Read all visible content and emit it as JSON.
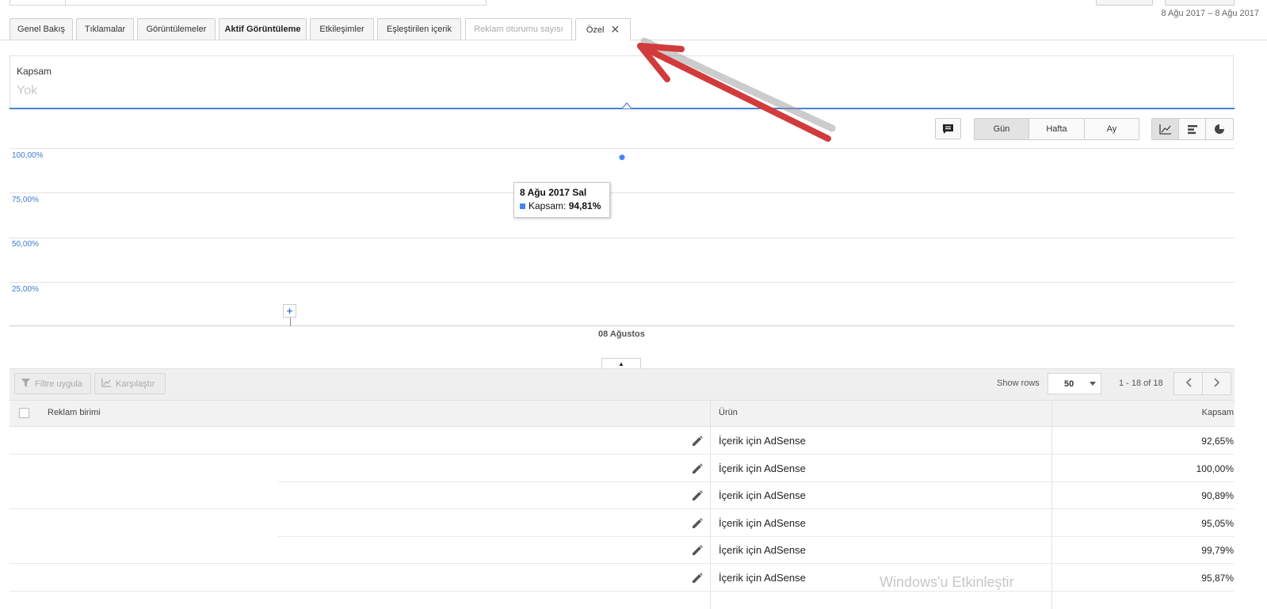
{
  "header": {
    "date_range": "8 Ağu 2017 – 8 Ağu 2017"
  },
  "tabs": [
    {
      "label": "Genel Bakış"
    },
    {
      "label": "Tıklamalar"
    },
    {
      "label": "Görüntülemeler"
    },
    {
      "label": "Aktif Görüntüleme"
    },
    {
      "label": "Etkileşimler"
    },
    {
      "label": "Eşleştirilen içerik"
    },
    {
      "label": "Reklam oturumu sayısı"
    },
    {
      "label": "Özel",
      "close": "✕"
    }
  ],
  "scope": {
    "label": "Kapsam",
    "value": "Yok"
  },
  "chart_toolbar": {
    "comment_icon": "comment-icon",
    "period": [
      "Gün",
      "Hafta",
      "Ay"
    ],
    "selected_period": "Gün",
    "view_icons": [
      "line-chart-icon",
      "bar-chart-icon",
      "pie-chart-icon"
    ]
  },
  "chart_data": {
    "type": "line",
    "y_ticks": [
      "100,00%",
      "75,00%",
      "50,00%",
      "25,00%"
    ],
    "x_labels": [
      "08 Ağustos"
    ],
    "series": [
      {
        "name": "Kapsam",
        "values": [
          94.81
        ]
      }
    ],
    "tooltip": {
      "date": "8 Ağu 2017 Sal",
      "label": "Kapsam:",
      "value": "94,81%"
    }
  },
  "table_toolbar": {
    "filter_label": "Filtre uygula",
    "compare_label": "Karşılaştır",
    "show_rows_label": "Show rows",
    "rows_value": "50",
    "pager_text": "1 - 18 of 18"
  },
  "table": {
    "columns": [
      "Reklam birimi",
      "Ürün",
      "Kapsam"
    ],
    "rows": [
      {
        "product": "İçerik için AdSense",
        "value": "92,65%"
      },
      {
        "product": "İçerik için AdSense",
        "value": "100,00%"
      },
      {
        "product": "İçerik için AdSense",
        "value": "90,89%"
      },
      {
        "product": "İçerik için AdSense",
        "value": "95,05%"
      },
      {
        "product": "İçerik için AdSense",
        "value": "99,79%"
      },
      {
        "product": "İçerik için AdSense",
        "value": "95,87%"
      }
    ]
  },
  "overlay": {
    "watermark": "Windows'u Etkinleştir",
    "arrow_color": "#d23b3b"
  }
}
